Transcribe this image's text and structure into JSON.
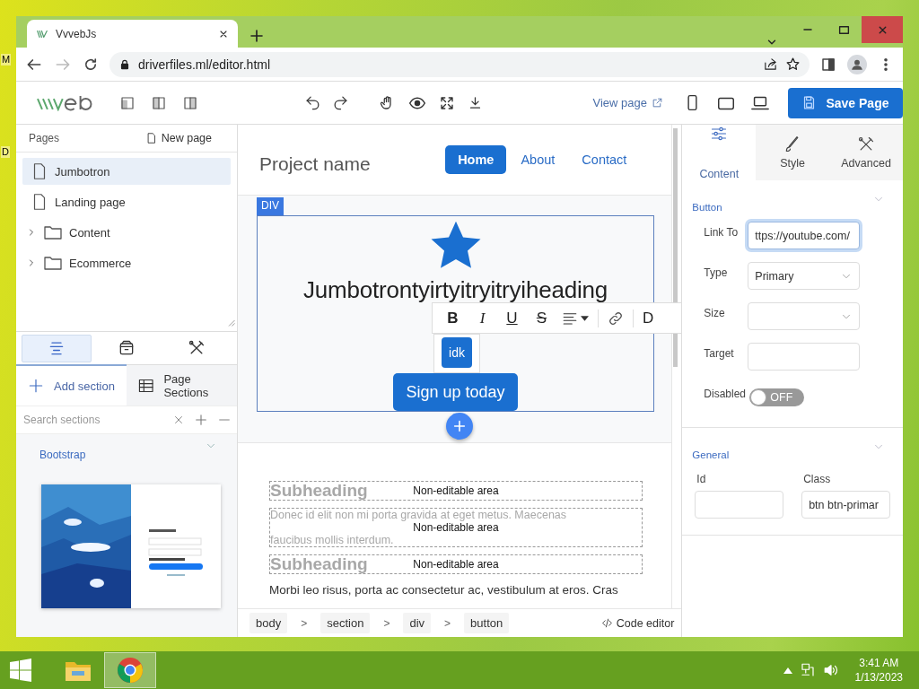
{
  "desktop_icons": [
    {
      "label": "M"
    },
    {
      "label": "D"
    }
  ],
  "browser": {
    "tab_title": "VvvebJs",
    "url": "driverfiles.ml/editor.html"
  },
  "toolbar": {
    "view_page": "View page",
    "save": "Save Page"
  },
  "pages": {
    "title": "Pages",
    "new_page": "New page",
    "items": [
      {
        "kind": "page",
        "label": "Jumbotron",
        "selected": true
      },
      {
        "kind": "page",
        "label": "Landing page",
        "selected": false
      },
      {
        "kind": "folder",
        "label": "Content",
        "selected": false,
        "expanded": false
      },
      {
        "kind": "folder",
        "label": "Ecommerce",
        "selected": false,
        "expanded": false
      }
    ]
  },
  "panel_tabs": [
    {
      "selected": true
    },
    {
      "selected": false
    },
    {
      "selected": false
    }
  ],
  "section_tabs": [
    {
      "label": "Add section",
      "selected": true
    },
    {
      "label": "Page Sections",
      "selected": false
    }
  ],
  "search": {
    "placeholder": "Search sections"
  },
  "group": {
    "title": "Bootstrap",
    "expanded": true
  },
  "canvas": {
    "brand": "Project name",
    "nav": [
      {
        "label": "Home",
        "selected": true
      },
      {
        "label": "About",
        "selected": false
      },
      {
        "label": "Contact",
        "selected": false
      }
    ],
    "selection_tag": "DIV",
    "heading": "Jumbotrontyirtyitryitryiheading",
    "button": "Sign up today",
    "format_buttons": [
      {
        "label": "B",
        "kind": "bold"
      },
      {
        "label": "I",
        "kind": "italic"
      },
      {
        "label": "U",
        "kind": "underline"
      },
      {
        "label": "S",
        "kind": "strike"
      }
    ],
    "format_cut": "D",
    "popup_button": "idk",
    "non_editable": [
      {
        "kind": "heading",
        "ghost_lines": [
          "Subheading"
        ],
        "label": "Non-editable area"
      },
      {
        "kind": "paragraph",
        "ghost_lines": [
          "Donec id elit non mi porta gravida at eget metus. Maecenas",
          "faucibus mollis interdum."
        ],
        "label": "Non-editable area"
      },
      {
        "kind": "heading",
        "ghost_lines": [
          "Subheading"
        ],
        "label": "Non-editable area"
      }
    ],
    "paragraph": "Morbi leo risus, porta ac consectetur ac, vestibulum at eros. Cras",
    "breadcrumb": [
      {
        "kind": "crumb",
        "label": "body"
      },
      {
        "kind": "separator",
        "label": ">"
      },
      {
        "kind": "crumb",
        "label": "section"
      },
      {
        "kind": "separator",
        "label": ">"
      },
      {
        "kind": "crumb",
        "label": "div"
      },
      {
        "kind": "separator",
        "label": ">"
      },
      {
        "kind": "crumb",
        "label": "button"
      }
    ],
    "code_editor": "Code editor"
  },
  "properties": {
    "tabs": [
      {
        "label": "Content",
        "selected": true
      },
      {
        "label": "Style",
        "selected": false
      },
      {
        "label": "Advanced",
        "selected": false
      }
    ],
    "sections": [
      {
        "title": "Button",
        "expanded": true,
        "kind": "rows",
        "fields": [
          {
            "kind": "text",
            "label": "Link To",
            "value": "ttps://youtube.com/",
            "focused": true
          },
          {
            "kind": "select",
            "label": "Type",
            "value": "Primary",
            "focused": false
          },
          {
            "kind": "select",
            "label": "Size",
            "focused": false
          },
          {
            "kind": "text",
            "label": "Target",
            "focused": false
          },
          {
            "kind": "toggle",
            "label": "Disabled",
            "on": false,
            "state_label": "OFF"
          }
        ]
      },
      {
        "title": "General",
        "expanded": true,
        "kind": "grid",
        "fields": [
          {
            "kind": "text",
            "label": "Id",
            "focused": false
          },
          {
            "kind": "text",
            "label": "Class",
            "value": "btn btn-primar",
            "focused": false
          }
        ]
      }
    ]
  },
  "taskbar": {
    "time": "3:41 AM",
    "date": "1/13/2023"
  }
}
